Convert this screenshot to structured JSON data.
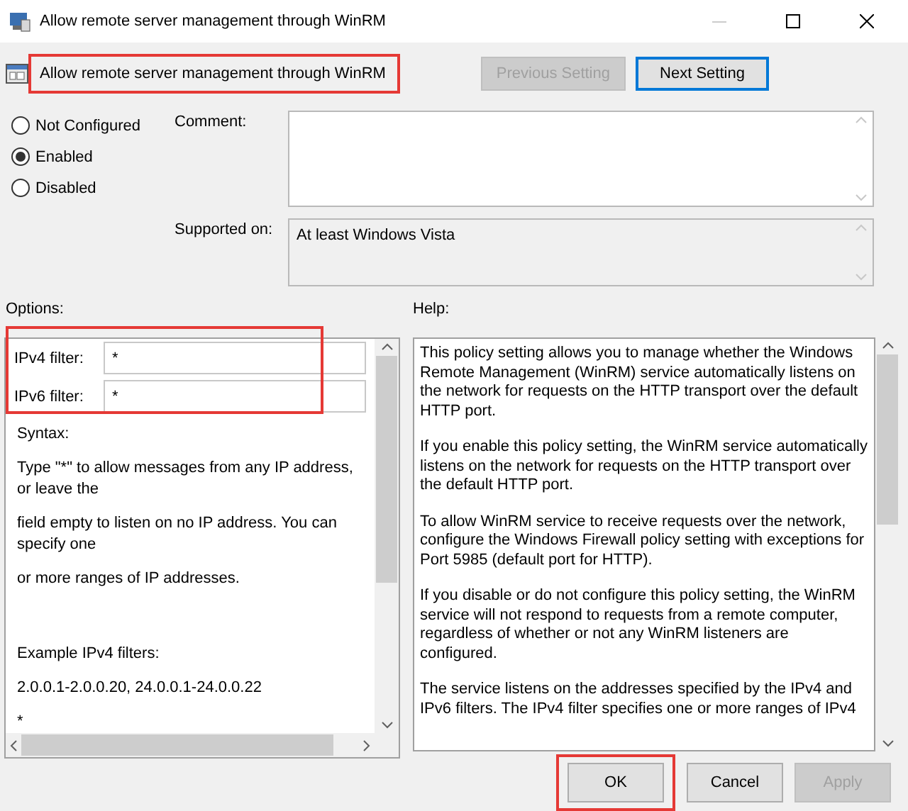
{
  "window": {
    "title": "Allow remote server management through WinRM"
  },
  "header": {
    "title": "Allow remote server management through WinRM",
    "highlighted": true
  },
  "nav_buttons": [
    {
      "label": "Previous Setting",
      "disabled": true,
      "focused": false
    },
    {
      "label": "Next Setting",
      "disabled": false,
      "focused": true
    }
  ],
  "state_options": [
    {
      "label": "Not Configured",
      "selected": false
    },
    {
      "label": "Enabled",
      "selected": true
    },
    {
      "label": "Disabled",
      "selected": false
    }
  ],
  "comment": {
    "label": "Comment:"
  },
  "supported_on": {
    "label": "Supported on:",
    "value": "At least Windows Vista"
  },
  "options": {
    "label": "Options:",
    "highlighted": true,
    "fields": [
      {
        "label": "IPv4 filter:",
        "value": "*"
      },
      {
        "label": "IPv6 filter:",
        "value": "*"
      }
    ],
    "lines": [
      "Syntax:",
      "Type \"*\" to allow messages from any IP address, or leave the",
      "field empty to listen on no IP address. You can specify one",
      "or more ranges of IP addresses.",
      "Example IPv4 filters:",
      "2.0.0.1-2.0.0.20, 24.0.0.1-24.0.0.22",
      "*"
    ]
  },
  "help": {
    "label": "Help:",
    "paragraphs": [
      "This policy setting allows you to manage whether the Windows Remote Management (WinRM) service automatically listens on the network for requests on the HTTP transport over the default HTTP port.",
      "If you enable this policy setting, the WinRM service automatically listens on the network for requests on the HTTP transport over the default HTTP port.",
      "To allow WinRM service to receive requests over the network, configure the Windows Firewall policy setting with exceptions for Port 5985 (default port for HTTP).",
      "If you disable or do not configure this policy setting, the WinRM service will not respond to requests from a remote computer, regardless of whether or not any WinRM listeners are configured.",
      "The service listens on the addresses specified by the IPv4 and IPv6 filters. The IPv4 filter specifies one or more ranges of IPv4"
    ]
  },
  "footer_buttons": [
    {
      "label": "OK",
      "disabled": false,
      "highlighted": true
    },
    {
      "label": "Cancel",
      "disabled": false,
      "highlighted": false
    },
    {
      "label": "Apply",
      "disabled": true,
      "highlighted": false
    }
  ]
}
